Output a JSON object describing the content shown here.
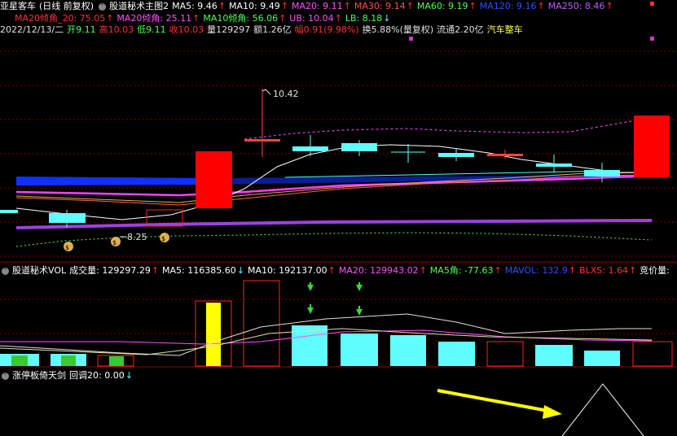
{
  "header1": {
    "stock_name": "亚星客车",
    "mode": "(日线 前复权)",
    "indicator": "股道秘术主图2",
    "items": [
      {
        "label": "MA5: 9.46",
        "color": "#ffffff",
        "arrow": "↑",
        "arrow_color": "#ff3030"
      },
      {
        "label": "MA10: 9.49",
        "color": "#ffffff",
        "arrow": "↑",
        "arrow_color": "#ff3030"
      },
      {
        "label": "MA20: 9.11",
        "color": "#ff50ff",
        "arrow": "↑",
        "arrow_color": "#ff3030"
      },
      {
        "label": "MA30: 9.14",
        "color": "#ff5050",
        "arrow": "↑",
        "arrow_color": "#ff3030"
      },
      {
        "label": "MA60: 9.19",
        "color": "#50ff50",
        "arrow": "↑",
        "arrow_color": "#ff3030"
      },
      {
        "label": "MA120: 9.16",
        "color": "#3050ff",
        "arrow": "↑",
        "arrow_color": "#ff3030"
      },
      {
        "label": "MA250: 8.46",
        "color": "#c060ff",
        "arrow": "↑",
        "arrow_color": "#ff3030"
      }
    ]
  },
  "header2": {
    "items": [
      {
        "label": "MA20倾角_20: 75.05",
        "color": "#ff3030",
        "arrow": "↑",
        "arrow_color": "#ff3030"
      },
      {
        "label": "MA20倾角: 25.11",
        "color": "#ff50ff",
        "arrow": "↑",
        "arrow_color": "#ff3030"
      },
      {
        "label": "MA10倾角: 56.06",
        "color": "#50ff50",
        "arrow": "↑",
        "arrow_color": "#ff3030"
      },
      {
        "label": "UB: 10.04",
        "color": "#ff50ff",
        "arrow": "↑",
        "arrow_color": "#ff3030"
      },
      {
        "label": "LB: 8.18",
        "color": "#50ff50",
        "arrow": "↓",
        "arrow_color": "#50ffff"
      }
    ]
  },
  "header3": {
    "items": [
      {
        "label": "2022/12/13/二",
        "color": "#e0e0e0"
      },
      {
        "label": "开9.11",
        "color": "#50ff50"
      },
      {
        "label": "高10.03",
        "color": "#ff3030"
      },
      {
        "label": "低9.11",
        "color": "#50ff50"
      },
      {
        "label": "收10.03",
        "color": "#ff3030"
      },
      {
        "label": "量129297",
        "color": "#e0e0e0"
      },
      {
        "label": "额1.26亿",
        "color": "#e0e0e0"
      },
      {
        "label": "幅0.91(9.98%)",
        "color": "#ff3030"
      },
      {
        "label": "换5.88%(量复权)",
        "color": "#e0e0e0"
      },
      {
        "label": "流通2.20亿",
        "color": "#e0e0e0"
      },
      {
        "label": "汽车整车",
        "color": "#ffff50"
      }
    ]
  },
  "price_labels": {
    "high": "10.42",
    "low": "8.25"
  },
  "vol_header": {
    "indicator": "股道秘术VOL",
    "items": [
      {
        "label": "成交量: 129297.29",
        "color": "#ffffff",
        "arrow": "↑",
        "arrow_color": "#ff3030"
      },
      {
        "label": "MA5: 116385.60",
        "color": "#ffffff",
        "arrow": "↓",
        "arrow_color": "#50ffff"
      },
      {
        "label": "MA10: 192137.00",
        "color": "#ffffff",
        "arrow": "↑",
        "arrow_color": "#ff3030"
      },
      {
        "label": "MA20: 129943.02",
        "color": "#ff50ff",
        "arrow": "↑",
        "arrow_color": "#ff3030"
      },
      {
        "label": "MA5角: -77.63",
        "color": "#50ff50",
        "arrow": "↑",
        "arrow_color": "#ff3030"
      },
      {
        "label": "MAVOL: 132.9",
        "color": "#3050ff",
        "arrow": "↑",
        "arrow_color": "#ff3030"
      },
      {
        "label": "BLXS: 1.64",
        "color": "#ff3030",
        "arrow": "↑",
        "arrow_color": "#ff3030"
      },
      {
        "label": "竞价量: ",
        "color": "#ffffff",
        "arrow": "",
        "arrow_color": "#ff3030"
      }
    ]
  },
  "sub_header": {
    "indicator": "涨停板倚天剑",
    "items": [
      {
        "label": "回调20: 0.00",
        "color": "#ffffff",
        "arrow": "↓",
        "arrow_color": "#50ffff"
      }
    ]
  },
  "colors": {
    "up": "#ff0000",
    "down": "#5fffff",
    "bg": "#000000",
    "grid": "#8a0000",
    "ub": "#ff50ff",
    "lb": "#50ff50"
  }
}
